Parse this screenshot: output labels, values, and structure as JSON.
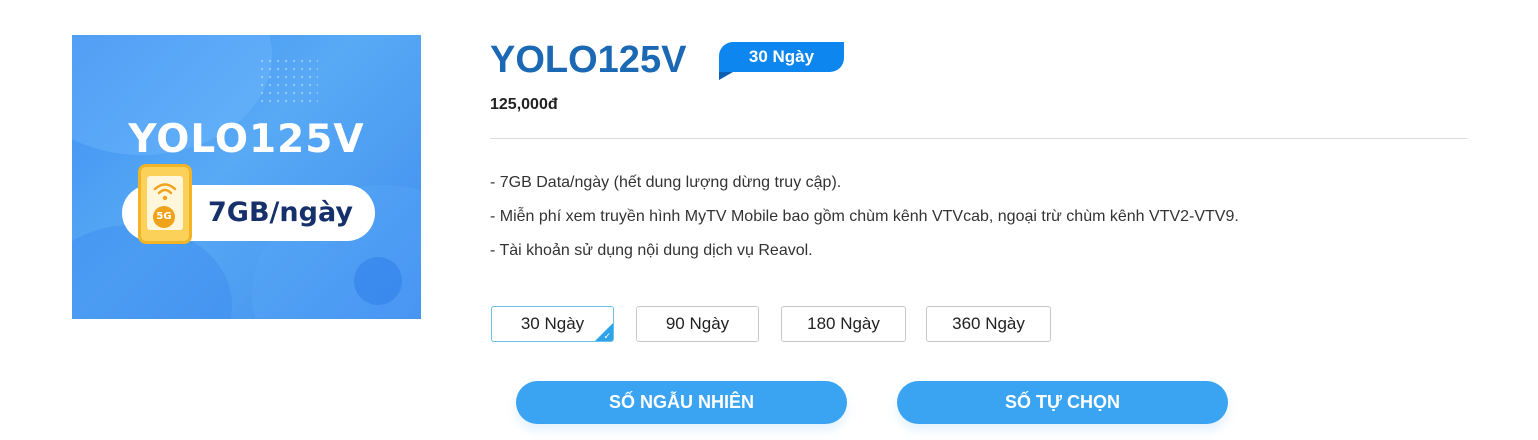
{
  "product_image": {
    "title": "YOLO125V",
    "data_text": "7GB/ngày",
    "phone_badge": "5G",
    "icon": "phone-5g-icon"
  },
  "plan": {
    "name": "YOLO125V",
    "duration_tag": "30 Ngày",
    "price": "125,000đ"
  },
  "features": [
    "- 7GB Data/ngày (hết dung lượng dừng truy cập).",
    "- Miễn phí xem truyền hình MyTV Mobile bao gồm chùm kênh VTVcab, ngoại trừ chùm kênh VTV2-VTV9.",
    "- Tài khoản sử dụng nội dung dịch vụ Reavol."
  ],
  "duration_options": [
    {
      "label": "30 Ngày",
      "selected": true
    },
    {
      "label": "90 Ngày",
      "selected": false
    },
    {
      "label": "180 Ngày",
      "selected": false
    },
    {
      "label": "360 Ngày",
      "selected": false
    }
  ],
  "actions": {
    "random_number": "SỐ NGẪU NHIÊN",
    "choose_number": "SỐ TỰ CHỌN"
  },
  "colors": {
    "brand_blue": "#1b69b4",
    "tag_blue": "#0e86f0",
    "button_blue": "#3aa4f3",
    "selected_border": "#6cc0e8"
  }
}
